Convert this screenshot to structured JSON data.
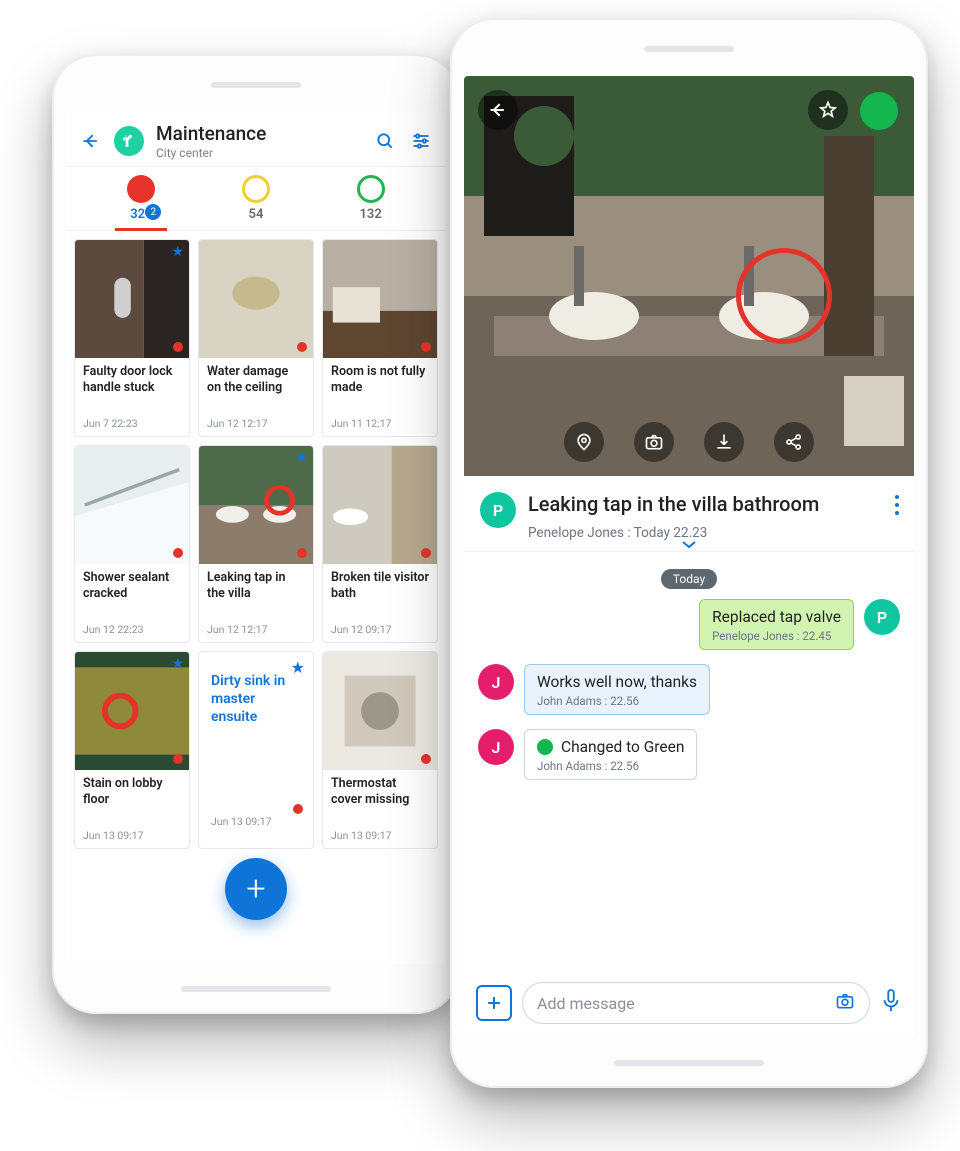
{
  "colors": {
    "accent": "#1074d8",
    "red": "#e5332a",
    "green": "#13b64f",
    "teal": "#0fc6a0",
    "pink": "#e51e6b"
  },
  "left": {
    "title": "Maintenance",
    "subtitle": "City center",
    "filters": {
      "red": {
        "count": "321",
        "badge": "2"
      },
      "yellow": {
        "count": "54"
      },
      "green": {
        "count": "132"
      }
    },
    "cards": [
      {
        "title": "Faulty door lock handle stuck",
        "date": "Jun 7 22:23",
        "starred": true
      },
      {
        "title": "Water damage on the ceiling",
        "date": "Jun 12 12:17",
        "starred": false
      },
      {
        "title": "Room is not fully made",
        "date": "Jun 11 12:17",
        "starred": false
      },
      {
        "title": "Shower sealant cracked",
        "date": "Jun 12 22:23",
        "starred": false
      },
      {
        "title": "Leaking tap in the villa",
        "date": "Jun 12 12:17",
        "starred": true
      },
      {
        "title": "Broken tile visitor bath",
        "date": "Jun 12 09:17",
        "starred": false
      },
      {
        "title": "Stain on lobby floor",
        "date": "Jun 13 09:17",
        "starred": true
      },
      {
        "title": "Dirty sink in master ensuite",
        "date": "Jun 13 09:17",
        "starred": true,
        "noImage": true
      },
      {
        "title": "Thermostat cover missing",
        "date": "Jun 13 09:17",
        "starred": false
      }
    ]
  },
  "right": {
    "issue_title": "Leaking tap in the villa bathroom",
    "byline": "Penelope Jones : Today 22.23",
    "reporter_initial": "P",
    "day_label": "Today",
    "messages": [
      {
        "side": "me",
        "style": "green",
        "avatar": "P",
        "text": "Replaced tap valve",
        "who": "Penelope Jones : 22.45"
      },
      {
        "side": "other",
        "style": "blue",
        "avatar": "J",
        "text": "Works well now, thanks",
        "who": "John Adams : 22.56"
      },
      {
        "side": "other",
        "style": "white",
        "avatar": "J",
        "text": "Changed to Green",
        "who": "John Adams : 22.56",
        "status": true
      }
    ],
    "composer_placeholder": "Add message"
  }
}
